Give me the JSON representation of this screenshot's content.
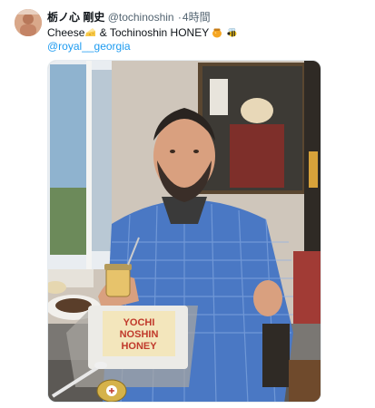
{
  "tweet": {
    "author_name": "栃ノ心 剛史",
    "handle": "@tochinoshin",
    "separator": "·",
    "timestamp": "4時間",
    "text_part1": "Cheese",
    "text_part2": " & Tochinoshin HONEY",
    "mention": "@royal__georgia",
    "emojis": [
      "cheese-wedge-icon",
      "honey-pot-icon",
      "bee-icon"
    ]
  },
  "photo": {
    "jar_label": "YOCHI\nNOSHIN\nHONEY",
    "jar_label_line1": "YOCHI",
    "jar_label_line2": "NOSHIN",
    "jar_label_line3": "HONEY"
  }
}
